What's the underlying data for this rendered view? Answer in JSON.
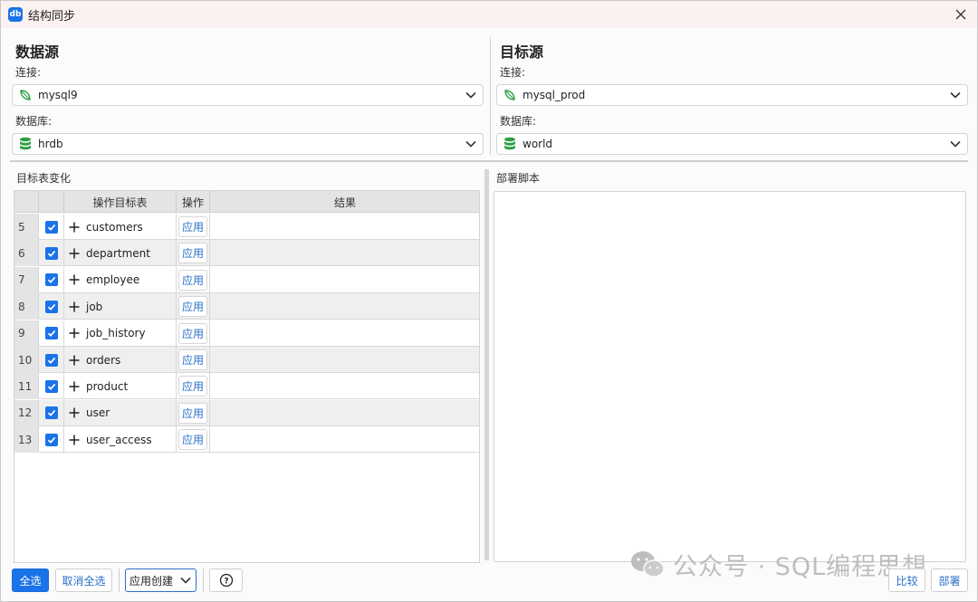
{
  "window": {
    "app_icon_text": "db",
    "title": "结构同步"
  },
  "source": {
    "heading": "数据源",
    "connection_label": "连接:",
    "connection_value": "mysql9",
    "database_label": "数据库:",
    "database_value": "hrdb"
  },
  "target": {
    "heading": "目标源",
    "connection_label": "连接:",
    "connection_value": "mysql_prod",
    "database_label": "数据库:",
    "database_value": "world"
  },
  "changes": {
    "section_label": "目标表变化",
    "columns": [
      "",
      "",
      "操作目标表",
      "操作",
      "结果"
    ],
    "apply_label": "应用",
    "rows": [
      {
        "num": "5",
        "name": "customers",
        "checked": true
      },
      {
        "num": "6",
        "name": "department",
        "checked": true
      },
      {
        "num": "7",
        "name": "employee",
        "checked": true
      },
      {
        "num": "8",
        "name": "job",
        "checked": true
      },
      {
        "num": "9",
        "name": "job_history",
        "checked": true
      },
      {
        "num": "10",
        "name": "orders",
        "checked": true
      },
      {
        "num": "11",
        "name": "product",
        "checked": true
      },
      {
        "num": "12",
        "name": "user",
        "checked": true
      },
      {
        "num": "13",
        "name": "user_access",
        "checked": true
      }
    ]
  },
  "script": {
    "section_label": "部署脚本"
  },
  "toolbar": {
    "select_all": "全选",
    "deselect_all": "取消全选",
    "apply_mode": "应用创建",
    "help": "?",
    "compare": "比较",
    "deploy": "部署"
  },
  "watermark": {
    "text": "公众号 · SQL编程思想"
  },
  "colors": {
    "accent": "#1a73e8",
    "title_bar": "#fbf1f1",
    "link_blue": "#2a6fc9",
    "mysql_leaf": "#2e9e44",
    "database_green": "#2e9e44"
  }
}
